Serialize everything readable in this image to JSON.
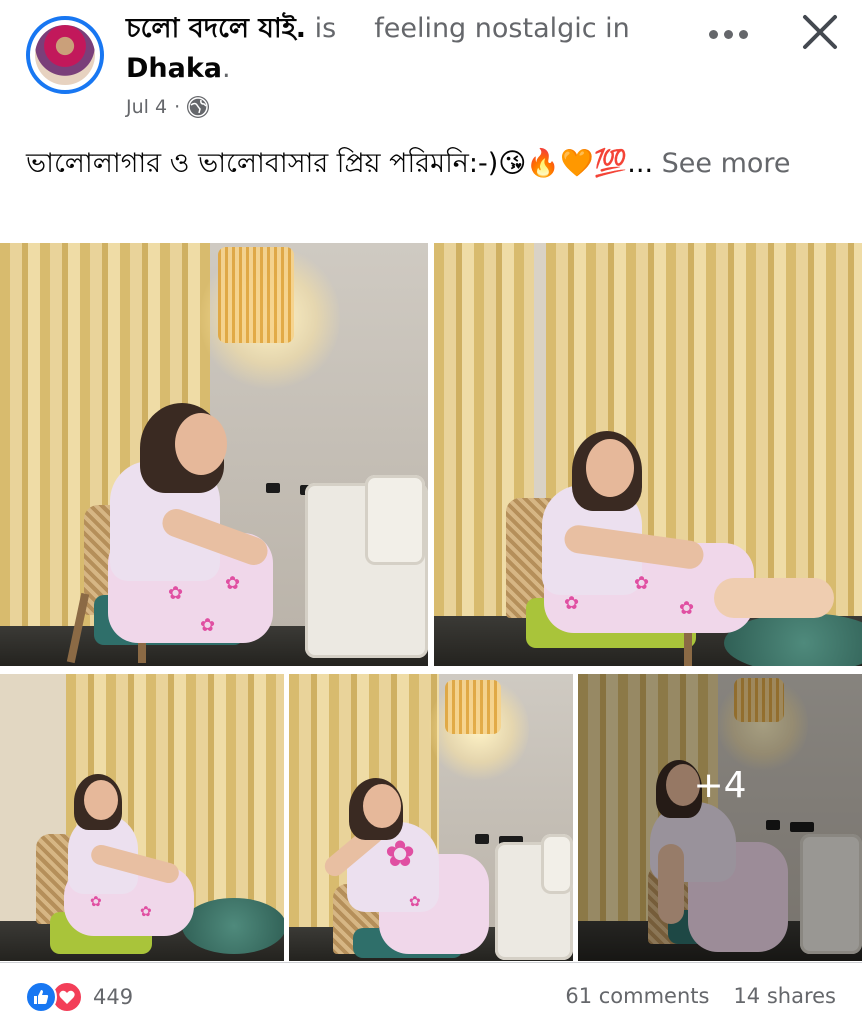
{
  "post": {
    "author_name": "চলো বদলে যাই.",
    "is_text": "is",
    "activity": "feeling nostalgic in",
    "location": "Dhaka",
    "location_suffix": ".",
    "date": "Jul 4",
    "dot": "·",
    "privacy_icon": "globe-icon",
    "caption": "ভালোলাগার ও ভালোবাসার প্রিয় পরিমনি:-)😘🔥🧡💯...",
    "see_more": "See more"
  },
  "header_actions": {
    "more_icon": "ellipsis-icon",
    "close_icon": "close-icon"
  },
  "photos": {
    "more_count": "+4"
  },
  "footer": {
    "reaction_count": "449",
    "comments": "61 comments",
    "shares": "14 shares"
  },
  "colors": {
    "accent": "#1877f2",
    "love": "#f33e58",
    "muted_text": "#65676b"
  }
}
